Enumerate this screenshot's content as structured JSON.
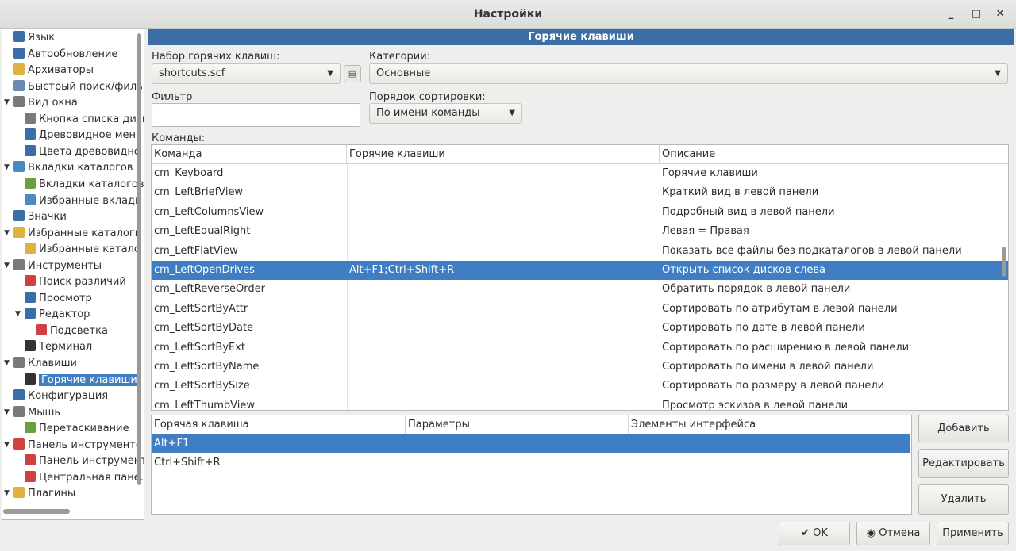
{
  "window": {
    "title": "Настройки",
    "minimize": "_",
    "maximize": "□",
    "close": "✕"
  },
  "tree": [
    {
      "label": "Язык",
      "icon": "language-icon",
      "color": "#3a6ea5"
    },
    {
      "label": "Автообновление",
      "icon": "refresh-icon",
      "color": "#3a6ea5"
    },
    {
      "label": "Архиваторы",
      "icon": "archive-icon",
      "color": "#e0b040"
    },
    {
      "label": "Быстрый поиск/филь",
      "icon": "search-icon",
      "color": "#6a8ab0"
    },
    {
      "label": "Вид окна",
      "icon": "window-icon",
      "color": "#7a7a7a"
    },
    {
      "label": "Кнопка списка диск",
      "icon": "drive-button-icon",
      "color": "#7a7a7a"
    },
    {
      "label": "Древовидное менк",
      "icon": "tree-menu-icon",
      "color": "#3a6ea5"
    },
    {
      "label": "Цвета древовидно",
      "icon": "tree-colors-icon",
      "color": "#3a6ea5"
    },
    {
      "label": "Вкладки каталогов",
      "icon": "tabs-icon",
      "color": "#4a8ac0"
    },
    {
      "label": "Вкладки каталогов",
      "icon": "tabs-folder-icon",
      "color": "#6aa040"
    },
    {
      "label": "Избранные вкладк",
      "icon": "favorite-tabs-icon",
      "color": "#4a8ac0"
    },
    {
      "label": "Значки",
      "icon": "icons-icon",
      "color": "#3a6ea5"
    },
    {
      "label": "Избранные каталоги",
      "icon": "favorite-folder-icon",
      "color": "#e0b040"
    },
    {
      "label": "Избранные катало",
      "icon": "favorite-folder-sub-icon",
      "color": "#e0b040"
    },
    {
      "label": "Инструменты",
      "icon": "tools-icon",
      "color": "#7a7a7a"
    },
    {
      "label": "Поиск различий",
      "icon": "diff-icon",
      "color": "#d04040"
    },
    {
      "label": "Просмотр",
      "icon": "viewer-icon",
      "color": "#3a6ea5"
    },
    {
      "label": "Редактор",
      "icon": "editor-icon",
      "color": "#3a6ea5"
    },
    {
      "label": "Подсветка",
      "icon": "highlight-icon",
      "color": "#d04040"
    },
    {
      "label": "Терминал",
      "icon": "terminal-icon",
      "color": "#333333"
    },
    {
      "label": "Клавиши",
      "icon": "keyboard-icon",
      "color": "#7a7a7a"
    },
    {
      "label": "Горячие клавиши",
      "icon": "hotkeys-icon",
      "color": "#333333"
    },
    {
      "label": "Конфигурация",
      "icon": "config-icon",
      "color": "#3a6ea5"
    },
    {
      "label": "Мышь",
      "icon": "mouse-icon",
      "color": "#7a7a7a"
    },
    {
      "label": "Перетаскивание",
      "icon": "drag-icon",
      "color": "#6aa040"
    },
    {
      "label": "Панель инструменто",
      "icon": "toolbar-icon",
      "color": "#d04040"
    },
    {
      "label": "Панель инструмент",
      "icon": "toolbar-sub-icon",
      "color": "#d04040"
    },
    {
      "label": "Центральная пане.",
      "icon": "center-panel-icon",
      "color": "#d04040"
    },
    {
      "label": "Плагины",
      "icon": "plugins-icon",
      "color": "#e0b040"
    }
  ],
  "panel": {
    "header": "Горячие клавиши",
    "set_label": "Набор горячих клавиш:",
    "set_value": "shortcuts.scf",
    "categories_label": "Категории:",
    "categories_value": "Основные",
    "filter_label": "Фильтр",
    "sort_label": "Порядок сортировки:",
    "sort_value": "По имени команды",
    "commands_label": "Команды:"
  },
  "commands": {
    "headers": [
      "Команда",
      "Горячие клавиши",
      "Описание"
    ],
    "rows": [
      [
        "cm_Keyboard",
        "",
        "Горячие клавиши"
      ],
      [
        "cm_LeftBriefView",
        "",
        "Краткий вид в левой панели"
      ],
      [
        "cm_LeftColumnsView",
        "",
        "Подробный вид в левой панели"
      ],
      [
        "cm_LeftEqualRight",
        "",
        "Левая = Правая"
      ],
      [
        "cm_LeftFlatView",
        "",
        "Показать все файлы без подкаталогов в левой панели"
      ],
      [
        "cm_LeftOpenDrives",
        "Alt+F1;Ctrl+Shift+R",
        "Открыть список дисков слева"
      ],
      [
        "cm_LeftReverseOrder",
        "",
        "Обратить порядок в левой панели"
      ],
      [
        "cm_LeftSortByAttr",
        "",
        "Сортировать по атрибутам в левой панели"
      ],
      [
        "cm_LeftSortByDate",
        "",
        "Сортировать по дате в левой панели"
      ],
      [
        "cm_LeftSortByExt",
        "",
        "Сортировать по расширению в левой панели"
      ],
      [
        "cm_LeftSortByName",
        "",
        "Сортировать по имени в левой панели"
      ],
      [
        "cm_LeftSortBySize",
        "",
        "Сортировать по размеру в левой панели"
      ],
      [
        "cm_LeftThumbView",
        "",
        "Просмотр эскизов в левой панели"
      ]
    ]
  },
  "hotkeys": {
    "headers": [
      "Горячая клавиша",
      "Параметры",
      "Элементы интерфейса"
    ],
    "rows": [
      [
        "Alt+F1",
        "",
        ""
      ],
      [
        "Ctrl+Shift+R",
        "",
        ""
      ]
    ]
  },
  "side_buttons": {
    "add": "Добавить",
    "edit": "Редактировать",
    "delete": "Удалить"
  },
  "dialog_buttons": {
    "ok": "OK",
    "cancel": "Отмена",
    "apply": "Применить"
  },
  "colors": {
    "accent": "#3f7ec2",
    "header": "#3a6ea5"
  }
}
